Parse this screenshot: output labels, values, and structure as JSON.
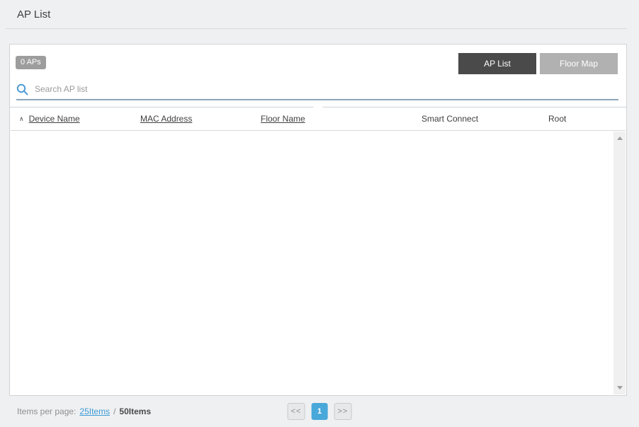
{
  "page": {
    "title": "AP List"
  },
  "panel": {
    "ap_count_badge": "0 APs",
    "view_toggle": {
      "ap_list_label": "AP List",
      "floor_map_label": "Floor Map",
      "selected": "AP List"
    },
    "search": {
      "placeholder": "Search AP list",
      "value": ""
    }
  },
  "table": {
    "sort_indicator": "∧",
    "sorted_column": "Device Name",
    "sort_direction": "asc",
    "columns": [
      {
        "label": "Device Name",
        "sortable": true
      },
      {
        "label": "MAC Address",
        "sortable": true
      },
      {
        "label": "Floor Name",
        "sortable": true
      },
      {
        "label": "Smart Connect",
        "sortable": false
      },
      {
        "label": "Root",
        "sortable": false
      }
    ],
    "rows": []
  },
  "footer": {
    "items_per_page_label": "Items per page:",
    "options": [
      {
        "label": "25Items",
        "selected": false
      },
      {
        "label": "50Items",
        "selected": true
      }
    ],
    "separator": "/",
    "pagination": {
      "prev_label": "<<",
      "current_page": "1",
      "next_label": ">>"
    }
  },
  "icons": {
    "search": "search-icon",
    "collapse": "chevron-down-icon",
    "scroll_up": "triangle-up-icon",
    "scroll_down": "triangle-down-icon"
  },
  "colors": {
    "page_background": "#eff0f2",
    "card_background": "#ffffff",
    "badge_gray": "#9d9d9d",
    "toggle_active": "#4a4a4b",
    "toggle_inactive": "#b1b1b2",
    "search_underline": "#8ba6b8",
    "search_icon_blue": "#4d9bd6",
    "link_blue": "#3d9bd5",
    "pagination_current_blue": "#49a8da"
  }
}
